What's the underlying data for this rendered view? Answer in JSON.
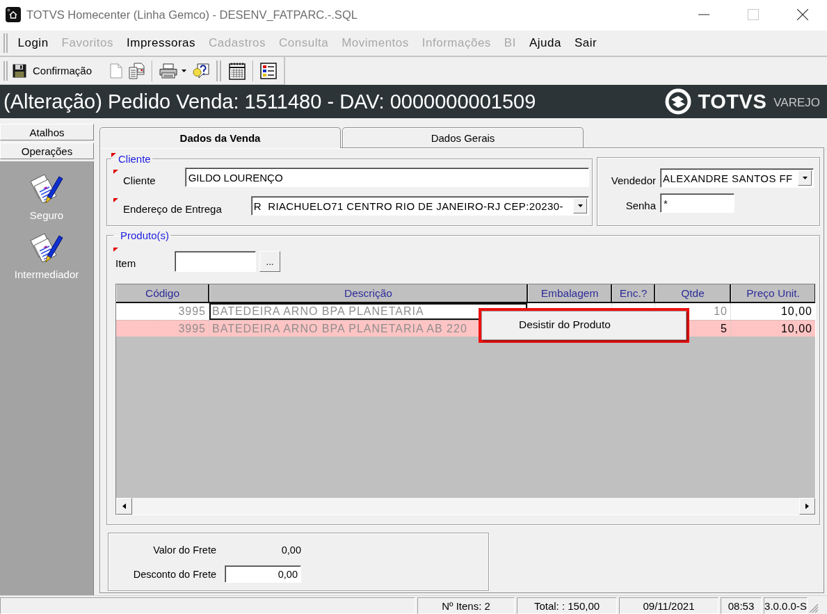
{
  "window": {
    "title": "TOTVS Homecenter (Linha Gemco) - DESENV_FATPARC.-.SQL"
  },
  "menu": [
    {
      "label": "Login",
      "disabled": false
    },
    {
      "label": "Favoritos",
      "disabled": true
    },
    {
      "label": "Impressoras",
      "disabled": false
    },
    {
      "label": "Cadastros",
      "disabled": true
    },
    {
      "label": "Consulta",
      "disabled": true
    },
    {
      "label": "Movimentos",
      "disabled": true
    },
    {
      "label": "Informações",
      "disabled": true
    },
    {
      "label": "BI",
      "disabled": true
    },
    {
      "label": "Ajuda",
      "disabled": false
    },
    {
      "label": "Sair",
      "disabled": false
    }
  ],
  "toolbar": [
    {
      "items": [
        {
          "kind": "save",
          "label": "Confirmação"
        },
        {
          "kind": "document"
        },
        {
          "kind": "documents"
        }
      ]
    },
    {
      "items": [
        {
          "kind": "printer"
        },
        {
          "kind": "help"
        }
      ]
    },
    {
      "items": [
        {
          "kind": "calendar"
        }
      ]
    },
    {
      "items": [
        {
          "kind": "list"
        }
      ]
    }
  ],
  "header": {
    "title": "(Alteração) Pedido Venda: 1511480 - DAV: 0000000001509",
    "logo": {
      "name": "TOTVS",
      "tagline": "VAREJO"
    }
  },
  "sidebar": {
    "sections": [
      {
        "label": "Atalhos"
      },
      {
        "label": "Operações",
        "items": [
          {
            "label": "Seguro"
          },
          {
            "label": "Intermediador"
          }
        ]
      }
    ]
  },
  "tabs": [
    {
      "label": "Dados da Venda",
      "selected": true
    },
    {
      "label": "Dados Gerais",
      "selected": false
    }
  ],
  "client_group": {
    "legend": "Cliente",
    "required": true,
    "fields": [
      {
        "kind": "text",
        "label": "Cliente",
        "value": "GILDO LOURENÇO",
        "required": true
      },
      {
        "kind": "dropdown",
        "label": "Endereço de Entrega",
        "value": "R  RIACHUELO71 CENTRO RIO DE JANEIRO-RJ CEP:20230-",
        "required": true
      }
    ]
  },
  "seller_group": {
    "fields": [
      {
        "kind": "dropdown",
        "label": "Vendedor",
        "value": "ALEXANDRE SANTOS FF"
      },
      {
        "kind": "text",
        "label": "Senha",
        "value": "*"
      }
    ]
  },
  "products_group": {
    "legend": "Produto(s)",
    "required": false,
    "item_field": {
      "label": "Item",
      "required": true,
      "button": "..."
    },
    "table": {
      "columns": [
        "Código",
        "Descrição",
        "Embalagem",
        "Enc.?",
        "Qtde",
        "Preço Unit."
      ],
      "rows": [
        {
          "selected": false,
          "focused": true,
          "qty_readonly": true,
          "code": "3995",
          "description": "BATEDEIRA ARNO BPA PLANETARIA",
          "quantity": "10",
          "unit_price": "10,00"
        },
        {
          "selected": true,
          "focused": false,
          "qty_readonly": false,
          "code": "3995",
          "description": "BATEDEIRA ARNO BPA PLANETARIA AB 220",
          "quantity": "5",
          "unit_price": "10,00"
        }
      ]
    }
  },
  "context_menu": {
    "items": [
      {
        "label": "Desistir do Produto"
      }
    ]
  },
  "freight_group": {
    "fields": [
      {
        "kind": "readonly",
        "label": "Valor do Frete",
        "value": "0,00"
      },
      {
        "kind": "input",
        "label": "Desconto do Frete",
        "value": "0,00"
      }
    ]
  },
  "status_bar": [
    "Nº Itens: 2",
    "Total: : 150,00",
    "09/11/2021",
    "08:53",
    "3.0.0.0-S"
  ]
}
